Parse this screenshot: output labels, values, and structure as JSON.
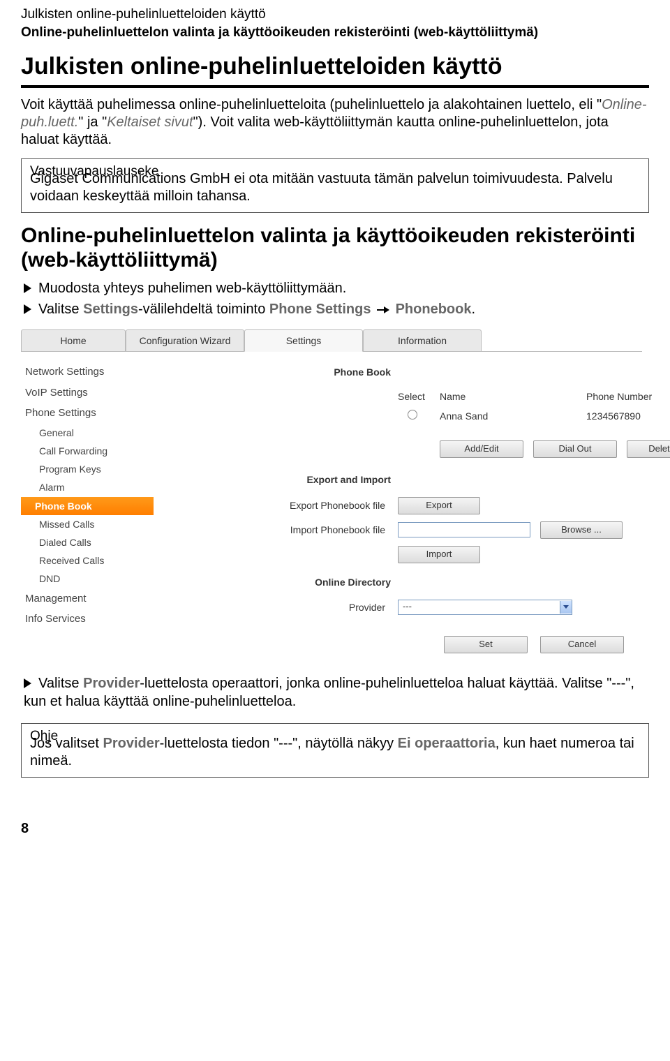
{
  "page_header": {
    "line1": "Julkisten online-puhelinluetteloiden käyttö",
    "line2": "Online-puhelinluettelon valinta ja käyttöoikeuden rekisteröinti (web-käyttöliittymä)"
  },
  "title": "Julkisten online-puhelinluetteloiden käyttö",
  "intro": {
    "p1a": "Voit käyttää puhelimessa online-puhelinluetteloita (puhelinluettelo ja alakohtainen luettelo, eli \"",
    "em1": "Online-puh.luett.",
    "p1b": "\" ja \"",
    "em2": "Keltaiset sivut",
    "p1c": "\"). Voit valita web-käyttöliittymän kautta online-puhelinluettelon, jota haluat käyttää."
  },
  "disclaimer": {
    "legend": "Vastuuvapauslauseke",
    "body": "Gigaset Communications GmbH ei ota mitään vastuuta tämän palvelun toimivuudesta. Palvelu voidaan keskeyttää milloin tahansa."
  },
  "h2": "Online-puhelinluettelon valinta ja käyttöoikeuden rekisteröinti (web-käyttöliittymä)",
  "steps": {
    "s1": "Muodosta yhteys puhelimen web-käyttöliittymään.",
    "s2a": "Valitse ",
    "s2b_settings": "Settings",
    "s2c": "-välilehdeltä toiminto ",
    "s2d_phone_settings": "Phone Settings",
    "s2e_phonebook": "Phonebook",
    "s2f": "."
  },
  "ui": {
    "tabs": [
      "Home",
      "Configuration Wizard",
      "Settings",
      "Information"
    ],
    "sidebar": {
      "top": [
        "Network Settings",
        "VoIP Settings",
        "Phone Settings"
      ],
      "sub": [
        "General",
        "Call Forwarding",
        "Program Keys",
        "Alarm",
        "Phone Book",
        "Missed Calls",
        "Dialed Calls",
        "Received Calls",
        "DND"
      ],
      "bottom": [
        "Management",
        "Info Services"
      ]
    },
    "content": {
      "phonebook_heading": "Phone Book",
      "col_select": "Select",
      "col_name": "Name",
      "col_phone": "Phone Number",
      "row_name": "Anna Sand",
      "row_number": "1234567890",
      "btn_addedit": "Add/Edit",
      "btn_dialout": "Dial Out",
      "btn_delete": "Delete",
      "exp_heading": "Export and Import",
      "exp_label": "Export Phonebook file",
      "btn_export": "Export",
      "imp_label": "Import Phonebook file",
      "btn_browse": "Browse ...",
      "btn_import": "Import",
      "online_heading": "Online Directory",
      "provider_label": "Provider",
      "provider_value": "---",
      "btn_set": "Set",
      "btn_cancel": "Cancel"
    }
  },
  "after_ui": {
    "s1a": "Valitse ",
    "s1b_provider": "Provider",
    "s1c": "-luettelosta operaattori, jonka online-puhelinluetteloa haluat käyttää. Valitse \"---\", kun et halua käyttää online-puhelinluetteloa."
  },
  "hint": {
    "legend": "Ohje",
    "a": "Jos valitset ",
    "provider": "Provider",
    "b": "-luettelosta tiedon \"---\",  näytöllä näkyy ",
    "no_op": "Ei operaattoria",
    "c": ", kun haet numeroa tai nimeä."
  },
  "page_number": "8"
}
